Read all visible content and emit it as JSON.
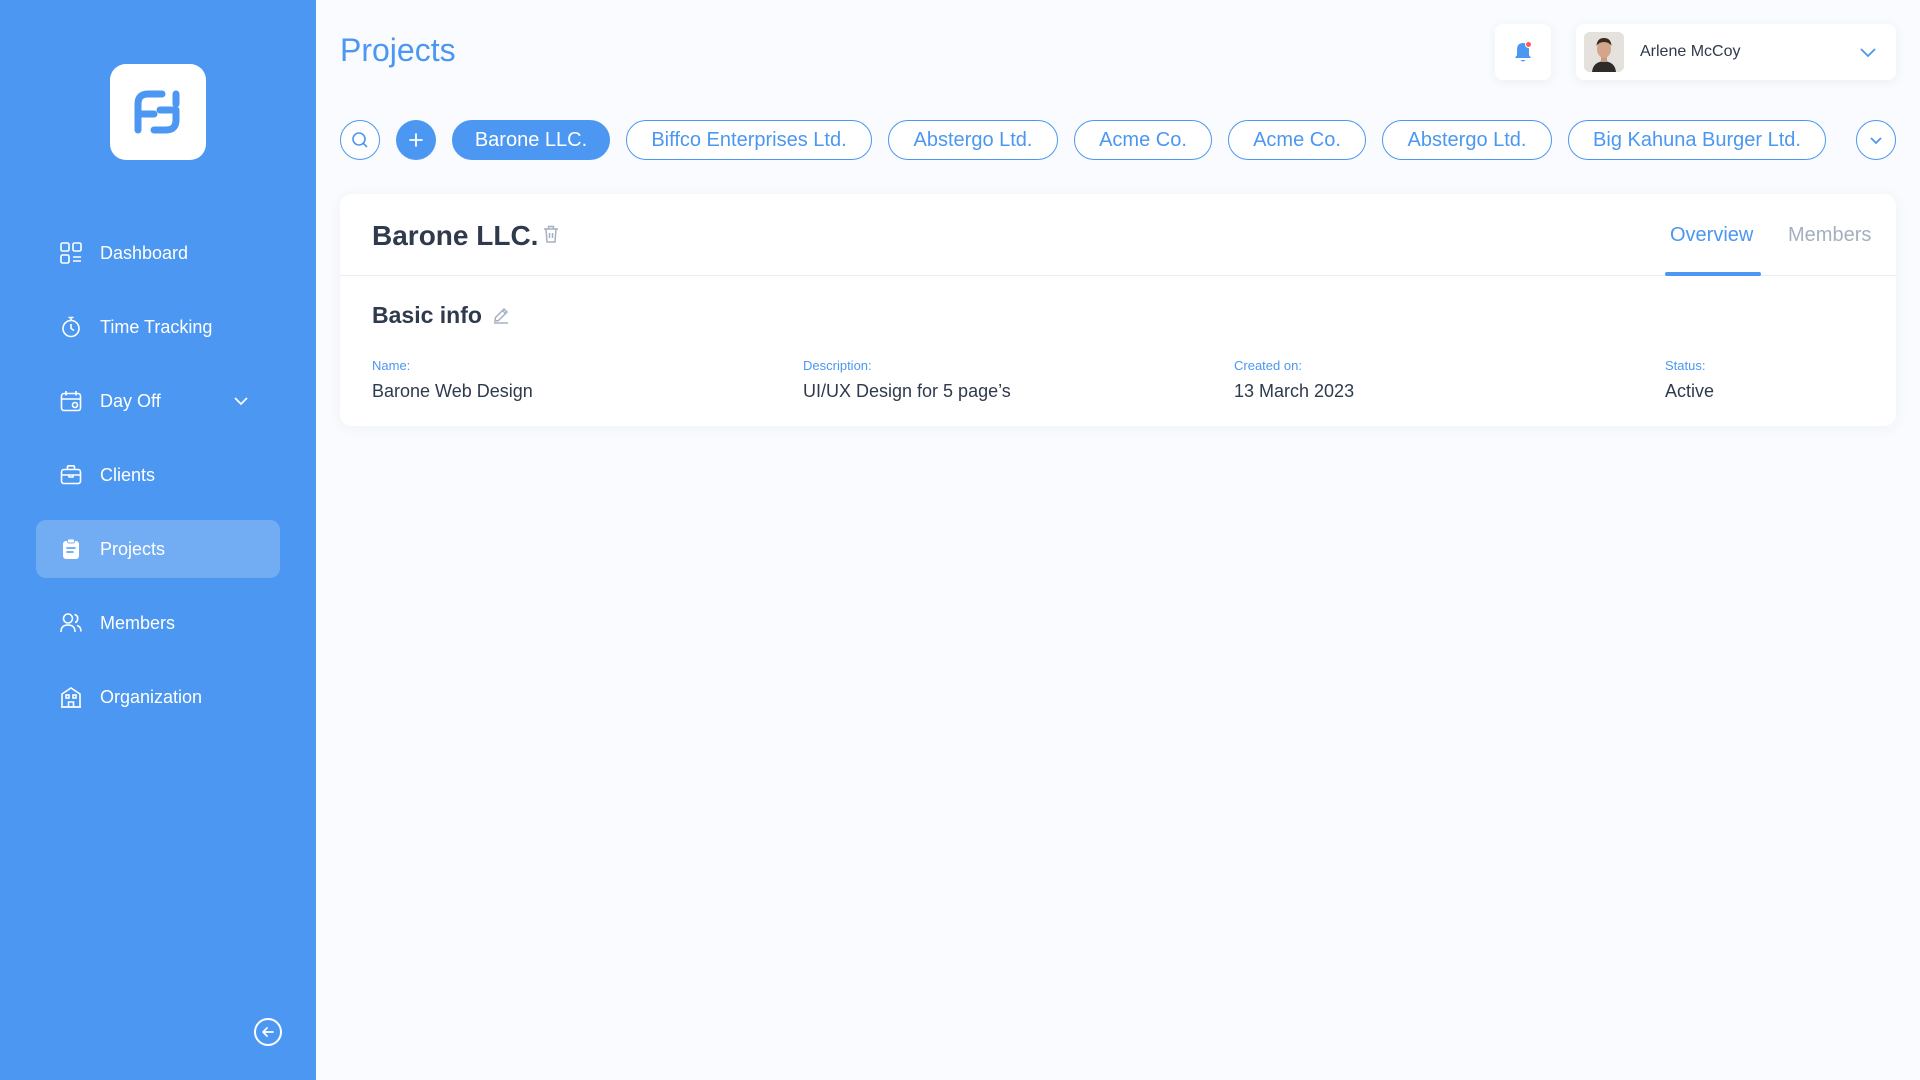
{
  "colors": {
    "accent": "#4b97f1",
    "sidebar_bg": "#4b97f1",
    "page_bg": "#f9fbfe",
    "text_dark": "#2f3a4c",
    "text_muted": "#a5b0bf",
    "notification_dot": "#ff5a5a"
  },
  "header": {
    "title": "Projects",
    "user_name": "Arlene McCoy"
  },
  "sidebar": {
    "items": [
      {
        "label": "Dashboard",
        "icon": "dashboard-icon"
      },
      {
        "label": "Time Tracking",
        "icon": "stopwatch-icon"
      },
      {
        "label": "Day Off",
        "icon": "calendar-icon",
        "has_submenu": true
      },
      {
        "label": "Clients",
        "icon": "briefcase-icon"
      },
      {
        "label": "Projects",
        "icon": "clipboard-icon",
        "active": true
      },
      {
        "label": "Members",
        "icon": "users-icon"
      },
      {
        "label": "Organization",
        "icon": "building-icon"
      }
    ]
  },
  "project_chips": [
    {
      "label": "Barone LLC.",
      "active": true
    },
    {
      "label": "Biffco Enterprises Ltd."
    },
    {
      "label": "Abstergo Ltd."
    },
    {
      "label": "Acme Co."
    },
    {
      "label": "Acme Co."
    },
    {
      "label": "Abstergo Ltd."
    },
    {
      "label": "Big Kahuna Burger Ltd."
    }
  ],
  "project": {
    "name": "Barone LLC.",
    "tabs": [
      {
        "label": "Overview",
        "active": true
      },
      {
        "label": "Members"
      }
    ],
    "section_title": "Basic info",
    "fields": [
      {
        "label": "Name:",
        "value": "Barone Web Design"
      },
      {
        "label": "Description:",
        "value": "UI/UX Design for 5 page’s"
      },
      {
        "label": "Created on:",
        "value": "13 March 2023"
      },
      {
        "label": "Status:",
        "value": "Active"
      }
    ]
  }
}
